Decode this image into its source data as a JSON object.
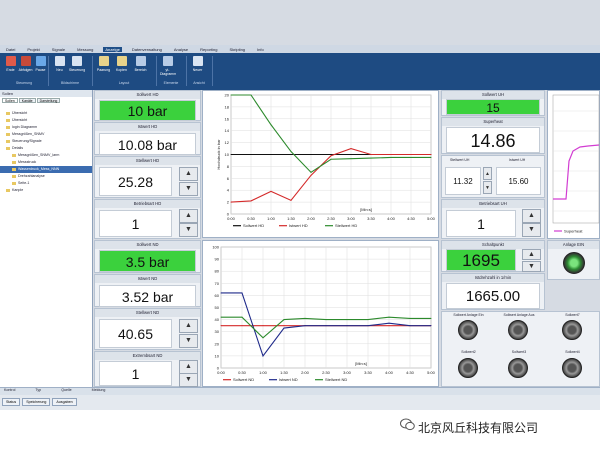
{
  "menu": [
    "Datei",
    "Projekt",
    "Signale",
    "Messung",
    "Anzeige",
    "Datenverwaltung",
    "Analyse",
    "Reporting",
    "Skripting",
    "Info"
  ],
  "menu_active": 4,
  "ribbon": {
    "buttons": [
      "Ende",
      "Abfolgen",
      "Pause",
      "Neu",
      "Steuerung",
      "Paarung",
      "Kopien",
      "Bereich",
      "yt-Diagramm",
      "Neuer"
    ],
    "groups": [
      "Steuerung",
      "Bildschirme",
      "Layout",
      "Elemente",
      "Ansicht"
    ]
  },
  "tree": {
    "header": "Sollen",
    "tabs": [
      "Sollen",
      "Kanäle",
      "Darstellung"
    ],
    "items": [
      "Übersicht",
      "Übersicht",
      "login Diagramm",
      "Messgrößen_SNMV",
      "Steuerung/Signale",
      "Details",
      "Messgrößen_SNMV_larm",
      "Messstruck",
      "Wasserdruck_Mess_NNN",
      "Drehzahlanalyse",
      "Seite-1",
      "Kanple"
    ]
  },
  "bottom": {
    "headers": [
      "Kontrol",
      "Typ",
      "Quelle",
      "Meldung"
    ],
    "tabs": [
      "Status",
      "Speicherung",
      "Ausgaben"
    ]
  },
  "hd": {
    "sollwert_title": "Sollwert HD",
    "sollwert": "10 bar",
    "istwert_title": "Istwert HD",
    "istwert": "10.08 bar",
    "stellwert_title": "Stellwert HD",
    "stellwert": "25.28",
    "betrieb_title": "Betriebsart HD",
    "betrieb": "1"
  },
  "nd": {
    "sollwert_title": "Sollwert ND",
    "sollwert": "3.5 bar",
    "istwert_title": "Istwert ND",
    "istwert": "3.52 bar",
    "stellwert_title": "Stellwert ND",
    "stellwert": "40.65",
    "betrieb_title": "Extrembsart ND",
    "betrieb": "1"
  },
  "uh": {
    "sollwert_title": "Sollwert UH",
    "sollwert": "15",
    "superheat_title": "Superheat",
    "superheat": "14.86",
    "stell_title": "Stellwert UH",
    "stell_a": "11.32",
    "ist_title": "Istwert UH",
    "stell_b": "15.60",
    "betrieb_title": "Betriebsart UH",
    "betrieb": "1"
  },
  "schalt": {
    "title": "Schaltpunkt",
    "value": "1695",
    "lamp_title": "Anlage EIN",
    "ist_title": "Istdrehzahl in 1/min",
    "ist": "1665.00"
  },
  "knobs": {
    "row1": [
      "Sollwert Anlage Ein",
      "Sollwert Anlage Aus",
      "Sollwert7"
    ],
    "row2": [
      "Sollwert2",
      "Sollwert3",
      "Sollwert4"
    ]
  },
  "right_chart": {
    "legend": [
      "Superheat"
    ]
  },
  "caption": "北京风丘科技有限公司",
  "chart_data": [
    {
      "type": "line",
      "title": "",
      "ylabel": "Hochdruck in bar",
      "xlabel": "[Min:s]",
      "ylim": [
        0,
        20
      ],
      "yticks": [
        0,
        2,
        4,
        6,
        8,
        10,
        12,
        14,
        16,
        18,
        20
      ],
      "xticks": [
        "0:00",
        "0:30",
        "1:00",
        "1:30",
        "2:00",
        "2:30",
        "3:00",
        "3:30",
        "4:00",
        "4:30",
        "5:00"
      ],
      "x": [
        0,
        0.5,
        1,
        1.5,
        2,
        2.5,
        3,
        3.5,
        4,
        4.5,
        5
      ],
      "series": [
        {
          "name": "Sollwert HD",
          "color": "#111111",
          "values": [
            10,
            10,
            10,
            10,
            10,
            10,
            10,
            10,
            10,
            10,
            10
          ]
        },
        {
          "name": "Istwert HD",
          "color": "#d42a2a",
          "values": [
            2,
            2.2,
            3.8,
            2.3,
            6.5,
            9.8,
            11,
            10,
            10,
            10,
            10
          ]
        },
        {
          "name": "Stellwert HD",
          "color": "#2c8a2c",
          "values": [
            20,
            20,
            15,
            10.5,
            7,
            9.2,
            9.3,
            9.4,
            9.5,
            9.5,
            9.5
          ]
        }
      ],
      "grid": true,
      "legend": "bottom"
    },
    {
      "type": "line",
      "title": "",
      "xlabel": "[Min:s]",
      "ylim": [
        0,
        100
      ],
      "yticks": [
        0,
        10,
        20,
        30,
        40,
        50,
        60,
        70,
        80,
        90,
        100
      ],
      "xticks": [
        "0:00",
        "0:30",
        "1:00",
        "1:30",
        "2:00",
        "2:30",
        "3:00",
        "3:30",
        "4:00",
        "4:30",
        "5:00"
      ],
      "x": [
        0,
        0.5,
        1,
        1.5,
        2,
        2.5,
        3,
        3.5,
        4,
        4.5,
        5
      ],
      "series": [
        {
          "name": "Sollwert ND",
          "color": "#d42a2a",
          "values": [
            35,
            35,
            35,
            35,
            35,
            35,
            35,
            35,
            35,
            35,
            35
          ]
        },
        {
          "name": "Istwert ND",
          "color": "#1f2a8a",
          "values": [
            62,
            62,
            10,
            33,
            35,
            35,
            35,
            35,
            37,
            35,
            35
          ]
        },
        {
          "name": "Stellwert ND",
          "color": "#2c8a2c",
          "values": [
            42,
            42,
            25,
            40,
            41,
            40,
            40,
            40,
            42,
            41,
            41
          ]
        }
      ],
      "grid": true,
      "legend": "bottom"
    }
  ]
}
